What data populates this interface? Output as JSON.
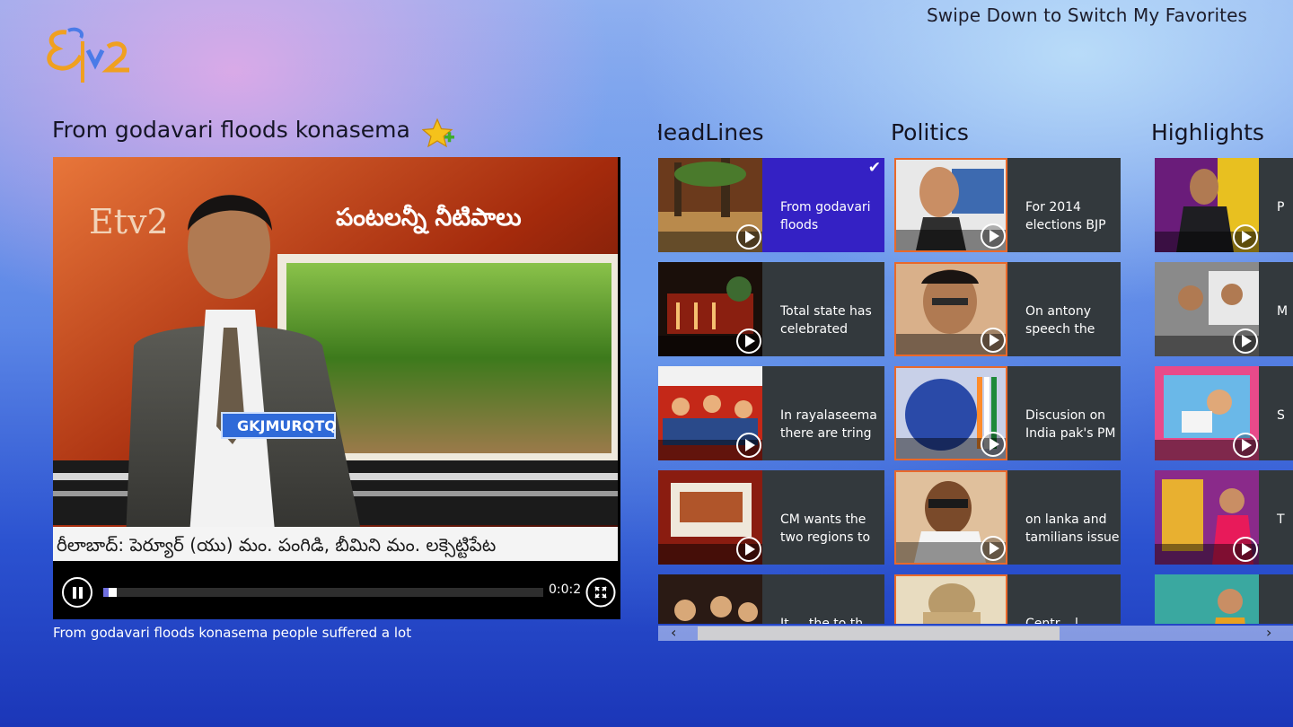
{
  "app": {
    "logo_name": "etv2-logo",
    "swipe_hint": "Swipe Down to Switch My Favorites"
  },
  "player": {
    "title": "From godavari floods konasema",
    "favorite_icon": "star-plus-icon",
    "telugu_banner": "పంటలన్నీ నీటిపాలు",
    "ticker_text": "రీలాబాద్: పెర్యూర్ (యు) మం. పంగిడి, బీమిని మం. లక్సెట్టిపేట",
    "nameplate": "GKJMURQTQ",
    "elapsed": "0:0:2",
    "progress_fraction": 0.02,
    "caption": "From godavari floods konasema people suffered a lot"
  },
  "sections": [
    {
      "title": "HeadLines",
      "tiles": [
        {
          "label": "From godavari floods",
          "selected": true
        },
        {
          "label": "Total state has celebrated"
        },
        {
          "label": "In rayalaseema there are tring"
        },
        {
          "label": "CM wants the two regions to"
        },
        {
          "label": "It ... the to th"
        }
      ]
    },
    {
      "title": "Politics",
      "tiles": [
        {
          "label": "For 2014 elections BJP"
        },
        {
          "label": "On antony speech the"
        },
        {
          "label": "Discusion on India pak's PM"
        },
        {
          "label": "on lanka and tamilians issue"
        },
        {
          "label": "Centr... l"
        }
      ]
    },
    {
      "title": "Highlights",
      "tiles": [
        {
          "label": "P"
        },
        {
          "label": "M"
        },
        {
          "label": "S"
        },
        {
          "label": "T"
        },
        {
          "label": ""
        }
      ]
    }
  ],
  "icons": {
    "play": "play-circle-icon",
    "pause": "pause-icon",
    "fullscreen": "fullscreen-icon",
    "check": "checkmark-icon"
  },
  "scrollbar": {
    "left_arrow": "‹",
    "right_arrow": "›"
  }
}
